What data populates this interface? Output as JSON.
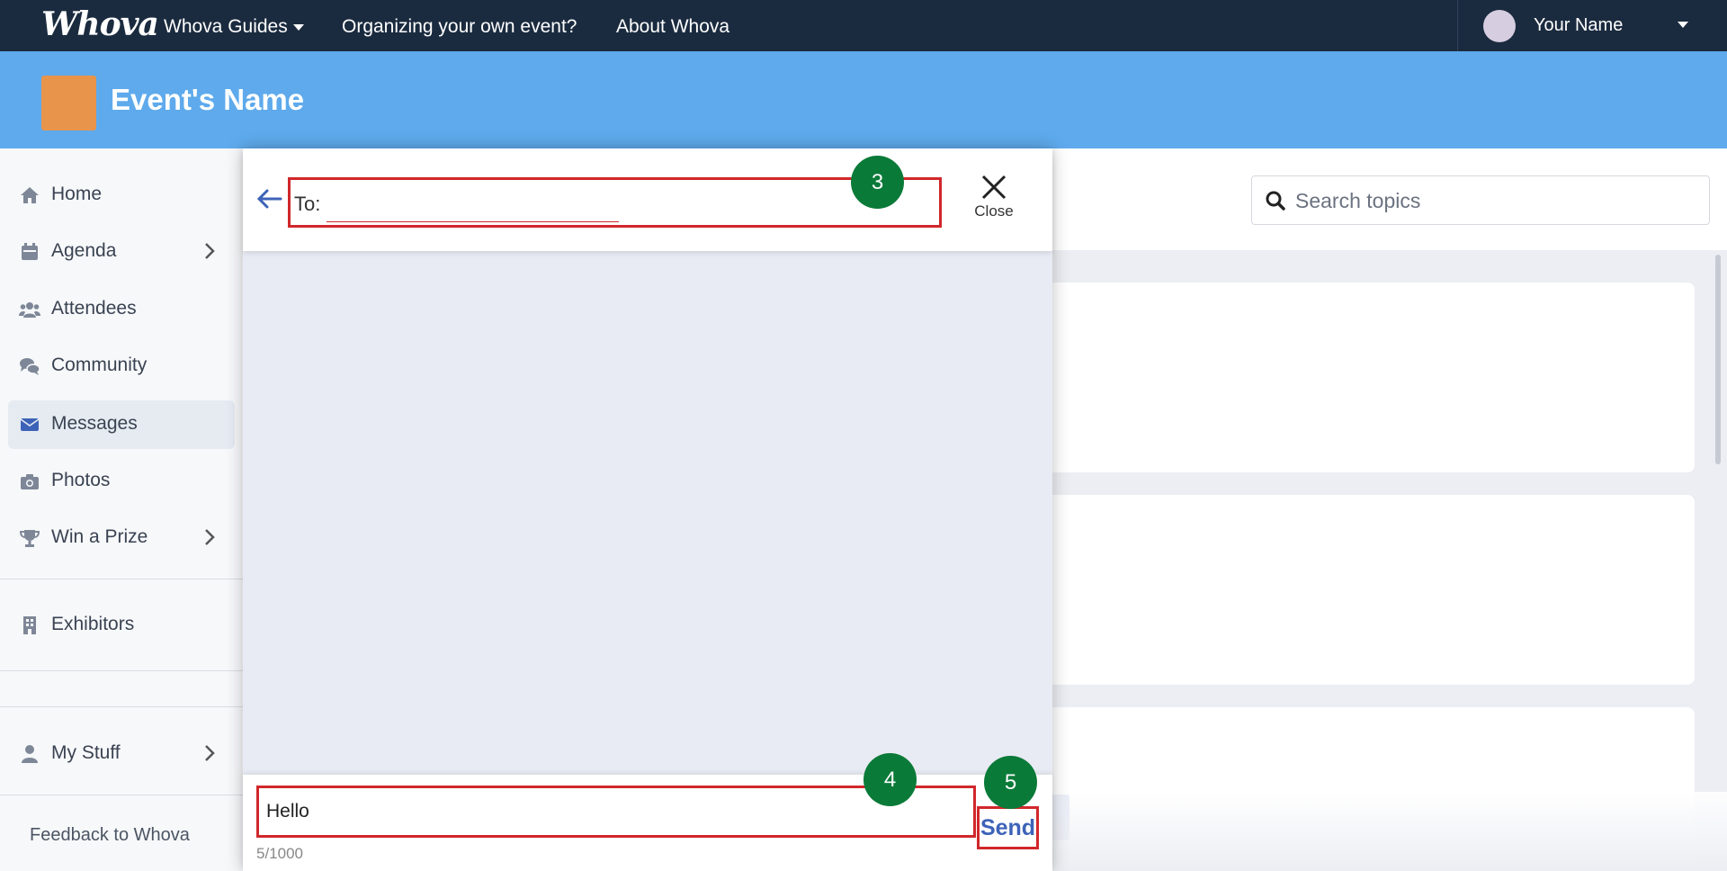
{
  "topnav": {
    "logo": "Whova",
    "items": [
      "Whova Guides",
      "Organizing your own event?",
      "About Whova"
    ],
    "user_name": "Your Name"
  },
  "event": {
    "name": "Event's Name"
  },
  "sidebar": {
    "items": [
      {
        "label": "Home",
        "icon": "home-icon"
      },
      {
        "label": "Agenda",
        "icon": "calendar-icon"
      },
      {
        "label": "Attendees",
        "icon": "users-icon"
      },
      {
        "label": "Community",
        "icon": "chat-icon"
      },
      {
        "label": "Messages",
        "icon": "envelope-icon"
      },
      {
        "label": "Photos",
        "icon": "camera-icon"
      },
      {
        "label": "Win a Prize",
        "icon": "trophy-icon"
      },
      {
        "label": "Exhibitors",
        "icon": "building-icon"
      },
      {
        "label": "My Stuff",
        "icon": "user-icon"
      }
    ],
    "feedback": "Feedback to Whova"
  },
  "search": {
    "placeholder": "Search topics"
  },
  "message_panel": {
    "to_label": "To:",
    "to_value": "",
    "close_label": "Close",
    "compose_value": "Hello",
    "char_count": "5/1000",
    "send_label": "Send"
  },
  "badges": [
    "3",
    "4",
    "5"
  ],
  "colors": {
    "nav_bg": "#1b2b3f",
    "header_bg": "#5eaaec",
    "highlight": "#d1272b",
    "badge": "#0a7a38",
    "accent": "#3d63b8"
  }
}
